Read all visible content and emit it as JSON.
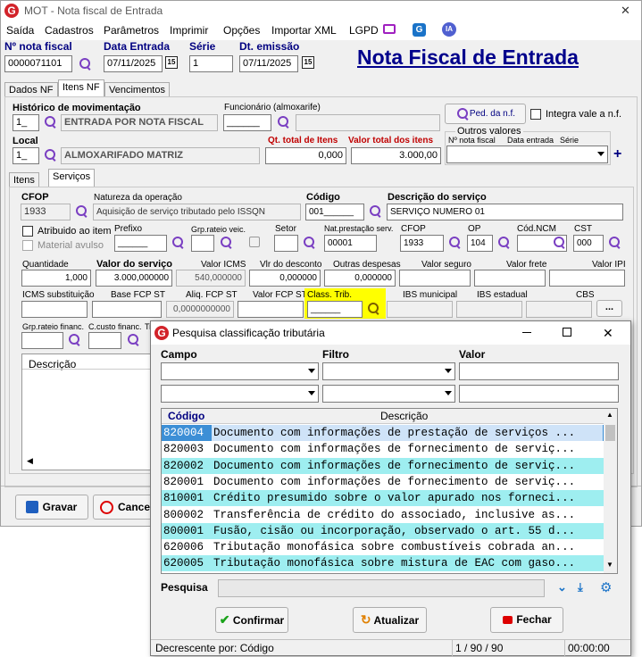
{
  "window": {
    "title": "MOT - Nota fiscal de Entrada",
    "close": "✕"
  },
  "menu": [
    "Saída",
    "Cadastros",
    "Parâmetros",
    "Imprimir",
    "Opções",
    "Importar XML",
    "LGPD"
  ],
  "header": {
    "nf_label": "Nº nota fiscal",
    "nf_value": "0000071101",
    "entrada_label": "Data Entrada",
    "entrada_value": "07/11/2025",
    "serie_label": "Série",
    "serie_value": "1",
    "emissao_label": "Dt. emissão",
    "emissao_value": "07/11/2025",
    "big_title": "Nota Fiscal de Entrada",
    "cal": "15"
  },
  "tabs": [
    "Dados NF",
    "Itens NF",
    "Vencimentos"
  ],
  "itens": {
    "hist_label": "Histórico de movimentação",
    "hist_code": "1_",
    "hist_desc": "ENTRADA POR NOTA FISCAL",
    "func_label": "Funcionário (almoxarife)",
    "func_value": "______",
    "ped_button": "Ped. da n.f.",
    "integra_label": "Integra vale a n.f.",
    "local_label": "Local",
    "local_code": "1_",
    "local_desc": "ALMOXARIFADO MATRIZ",
    "qt_label": "Qt. total de Itens",
    "qt_value": "0,000",
    "vt_label": "Valor total dos itens",
    "vt_value": "3.000,00",
    "outros_label": "Outros valores",
    "outros_cols": [
      "Nº nota fiscal",
      "Data entrada",
      "Série"
    ],
    "plus": "+"
  },
  "subtabs": [
    "Itens",
    "Serviços"
  ],
  "serv": {
    "cfop_label": "CFOP",
    "cfop_value": "1933",
    "natureza_label": "Natureza da operação",
    "natureza_value": "Aquisição de serviço tributado pelo ISSQN",
    "codigo_label": "Código",
    "codigo_value": "001______",
    "desc_label": "Descrição do serviço",
    "desc_value": "SERVIÇO NUMERO 01",
    "atrib_label": "Atribuido ao item",
    "material_label": "Material avulso",
    "prefixo_label": "Prefixo",
    "prefixo_value": "______",
    "grprateio_label": "Grp.rateio veic.",
    "setor_label": "Setor",
    "natprest_label": "Nat.prestação serv.",
    "natprest_value": "00001",
    "cfop2_label": "CFOP",
    "cfop2_value": "1933",
    "op_label": "OP",
    "op_value": "104",
    "ncm_label": "Cód.NCM",
    "cst_label": "CST",
    "cst_value": "000",
    "qtd_label": "Quantidade",
    "qtd_value": "1,000",
    "valor_label": "Valor do serviço",
    "valor_value": "3.000,000000",
    "icms_label": "Valor ICMS",
    "icms_value": "540,000000",
    "desconto_label": "Vlr do desconto",
    "desconto_value": "0,000000",
    "despesas_label": "Outras despesas",
    "despesas_value": "0,000000",
    "seguro_label": "Valor seguro",
    "frete_label": "Valor frete",
    "ipi_label": "Valor IPI",
    "icmsst_label": "ICMS substituição",
    "basefcp_label": "Base FCP ST",
    "aliq_label": "Aliq. FCP ST",
    "aliq_value": "0,0000000000",
    "valorfcp_label": "Valor FCP ST",
    "class_label": "Class. Trib.",
    "class_value": "______",
    "ibsmun_label": "IBS municipal",
    "ibsest_label": "IBS estadual",
    "cbs_label": "CBS",
    "more": "...",
    "grpfin_label": "Grp.rateio financ.",
    "ccusto_label": "C.custo financ.",
    "ti_label": "Ti",
    "descricao_col": "Descrição"
  },
  "buttons": {
    "gravar": "Gravar",
    "cancelar": "Cancel"
  },
  "dialog": {
    "title": "Pesquisa classificação tributária",
    "campo": "Campo",
    "filtro": "Filtro",
    "valor": "Valor",
    "col_codigo": "Código",
    "col_desc": "Descrição",
    "rows": [
      {
        "code": "820004",
        "desc": "Documento com informações de prestação de serviços ..."
      },
      {
        "code": "820003",
        "desc": "Documento com informações de fornecimento de serviç..."
      },
      {
        "code": "820002",
        "desc": "Documento com informações de fornecimento de serviç..."
      },
      {
        "code": "820001",
        "desc": "Documento com informações de fornecimento de serviç..."
      },
      {
        "code": "810001",
        "desc": "Crédito presumido sobre o valor apurado nos forneci..."
      },
      {
        "code": "800002",
        "desc": "Transferência de crédito do associado, inclusive as..."
      },
      {
        "code": "800001",
        "desc": "Fusão, cisão ou incorporação, observado o art. 55 d..."
      },
      {
        "code": "620006",
        "desc": "Tributação monofásica sobre combustíveis cobrada an..."
      },
      {
        "code": "620005",
        "desc": "Tributação monofásica sobre mistura de EAC com gaso..."
      }
    ],
    "pesquisa": "Pesquisa",
    "confirmar": "Confirmar",
    "atualizar": "Atualizar",
    "fechar": "Fechar",
    "status_left": "Decrescente por: Código",
    "status_mid": "1 / 90 / 90",
    "status_right": "00:00:00",
    "colors": {
      "selected": "#3c8fd6",
      "cyan": "#9eeef0",
      "white": "#ffffff"
    }
  }
}
